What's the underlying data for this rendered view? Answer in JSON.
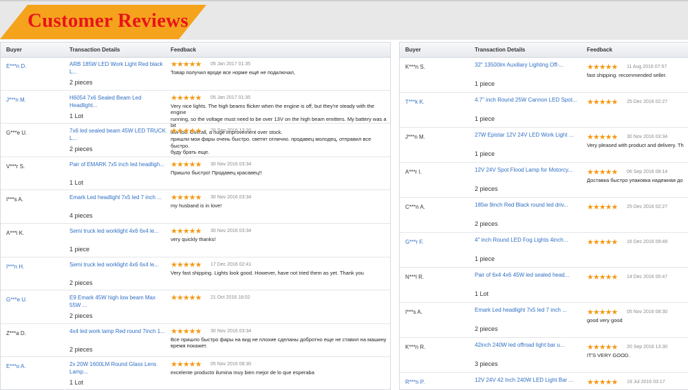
{
  "banner": {
    "title": "Customer Reviews"
  },
  "colors": {
    "accent": "#f5a31d",
    "title": "#e8141a",
    "link": "#2f6fc4",
    "star": "#f39a16"
  },
  "icons": {
    "star": "star-icon"
  },
  "table_headers": {
    "buyer": "Buyer",
    "transaction": "Transaction Details",
    "feedback": "Feedback"
  },
  "left_reviews": [
    {
      "buyer": "E***n D.",
      "product": "ARB 185W LED Work Light Red black L...",
      "qty": "2 pieces",
      "rating": 5,
      "date": "05 Jan 2017 01:35",
      "feedback": "Товар получил вроде все норме ещё не подключал,"
    },
    {
      "buyer": "J***n M.",
      "product": "H6054 7x6 Sealed Beam Led Headlight...",
      "qty": "1 Lot",
      "rating": 5,
      "date": "05 Jan 2017 01:35",
      "feedback": "Very nice lights. The high beams flicker when the engine is off, but they're steady with the engine\nrunning, so the voltage must need to be over 13V on the high beam emitters. My battery was a bit\nlow too. Overall, a huge improvement over stock."
    },
    {
      "buyer": "G***e U.",
      "product": "7x6 led sealed beam 45W LED TRUCK\nL...",
      "qty": "2 pieces",
      "rating": 5,
      "date": "20 Sep 2016 13:30",
      "feedback": "пришли мои фары очень быстро. светят отлично. продавец молодец, отправил все быстро.\nбуду брать еще."
    },
    {
      "buyer": "V***r S.",
      "product": "Pair of EMARK 7x5 inch led headligh...",
      "qty": "1 Lot",
      "rating": 5,
      "date": "30 Nov 2016 03:34",
      "feedback": "Пришло быстро! Продавец красавец!!"
    },
    {
      "buyer": "I***s A.",
      "product": "Emark Led headlight 7x5 led 7 inch ...",
      "qty": "4 pieces",
      "rating": 5,
      "date": "30 Nov 2016 03:34",
      "feedback": "my husband is in love!"
    },
    {
      "buyer": "A***i K.",
      "product": "Semi truck led worklight 4x6 6x4 le...",
      "qty": "1 piece",
      "rating": 5,
      "date": "30 Nov 2016 03:34",
      "feedback": "very quickly thanks!"
    },
    {
      "buyer": "I***n H.",
      "product": "Semi truck led worklight 4x6 6x4 le...",
      "qty": "2 pieces",
      "rating": 5,
      "date": "17 Dec 2016 02:41",
      "feedback": "Very fast shipping. Lights look good. However, have not tried them as yet. Thank you"
    },
    {
      "buyer": "G***e U.",
      "product": "E9 Emark 45W high low beam Max 55W ...",
      "qty": "2 pieces",
      "rating": 5,
      "date": "21 Oct 2016 18:02",
      "feedback": ""
    },
    {
      "buyer": "Z***a D.",
      "product": "4x4 led work lamp Red round 7inch 1...",
      "qty": "2 pieces",
      "rating": 5,
      "date": "30 Nov 2016 03:34",
      "feedback": "Все пришло быстро фары на вид не плохие сделаны добротно еще не ставил на машину\nвремя покажет."
    },
    {
      "buyer": "E***o A.",
      "product": "2x 20W 1600LM Round Glass Lens\nLamp...",
      "qty": "1 Lot",
      "rating": 5,
      "date": "05 Nov 2016 08:30",
      "feedback": "excelente producto ilumina muy bien mejor de lo que esperaba"
    }
  ],
  "right_reviews": [
    {
      "buyer": "K***n S.",
      "product": "32\" 13500lm Auxiliary Lighting Off-...",
      "qty": "1 piece",
      "rating": 5,
      "date": "11 Aug 2016 07:57",
      "feedback": "fast shipping. recommended seller."
    },
    {
      "buyer": "T***k K.",
      "product": "4.7\" inch Round 25W Cannon LED Spot...",
      "qty": "1 piece",
      "rating": 5,
      "date": "25 Dec 2016 02:27",
      "feedback": ""
    },
    {
      "buyer": "J***n M.",
      "product": "27W Epistar 12V 24V LED Work Light ...",
      "qty": "1 piece",
      "rating": 5,
      "date": "30 Nov 2016 03:34",
      "feedback": "Very pleased with product and delivery. Th"
    },
    {
      "buyer": "A***r I.",
      "product": "12V 24V Spot Flood Lamp for Motorcy...",
      "qty": "2 pieces",
      "rating": 5,
      "date": "06 Sep 2016 08:14",
      "feedback": "Доставка быстро упаковка надежная до"
    },
    {
      "buyer": "C***n A.",
      "product": "185w 9inch Red Black round led driv...",
      "qty": "2 pieces",
      "rating": 5,
      "date": "25 Dec 2016 02:27",
      "feedback": ""
    },
    {
      "buyer": "G***r F.",
      "product": "4\" inch Round LED Fog Lights 4inch...",
      "qty": "1 piece",
      "rating": 5,
      "date": "16 Dec 2016 09:49",
      "feedback": ""
    },
    {
      "buyer": "N***l R.",
      "product": "Pair of 6x4 4x6 45W led sealed head...",
      "qty": "1 Lot",
      "rating": 5,
      "date": "14 Dec 2016 00:47",
      "feedback": ""
    },
    {
      "buyer": "I***s A.",
      "product": "Emark Led headlight 7x5 led 7 inch ...",
      "qty": "2 pieces",
      "rating": 5,
      "date": "05 Nov 2016 08:30",
      "feedback": "good very good"
    },
    {
      "buyer": "K***n R.",
      "product": "42inch 240W led offroad light bar u...",
      "qty": "3 pieces",
      "rating": 5,
      "date": "20 Sep 2016 13:30",
      "feedback": "IT'S VERY GOOD."
    },
    {
      "buyer": "R***n P.",
      "product": "12V 24V 42 Inch 240W LED Light Bar ...",
      "qty": "",
      "rating": 5,
      "date": "19 Jul 2016 03:17",
      "feedback": ""
    }
  ]
}
